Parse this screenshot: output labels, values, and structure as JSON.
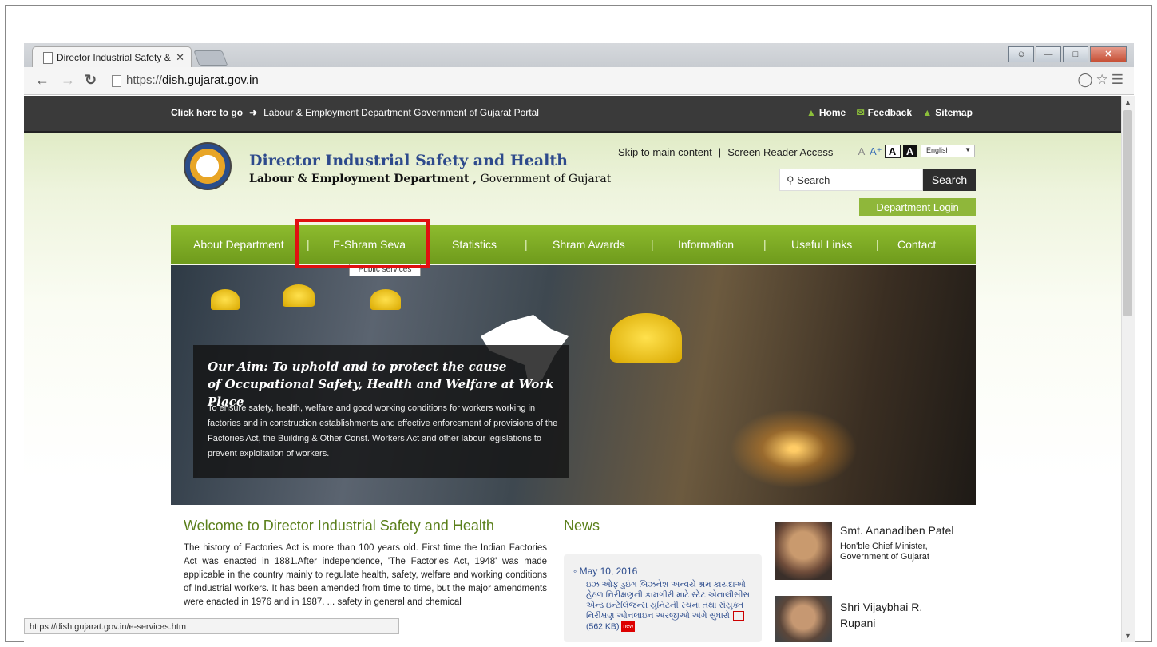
{
  "browser": {
    "tab_title": "Director Industrial Safety & ",
    "tab_close": "✕",
    "url_scheme": "https://",
    "url_domain": "dish.gujarat.gov.in",
    "status_url": "https://dish.gujarat.gov.in/e-services.htm"
  },
  "topbar": {
    "click_here": "Click here to go",
    "portal_link": "Labour & Employment Department Government of Gujarat Portal",
    "home": "Home",
    "feedback": "Feedback",
    "sitemap": "Sitemap"
  },
  "header": {
    "title": "Director Industrial Safety and Health",
    "subtitle_bold": "Labour & Employment Department ,",
    "subtitle_rest": " Government of Gujarat",
    "skip": "Skip to main content",
    "screen_reader": "Screen Reader Access",
    "font_sizes": [
      "A",
      "A⁺",
      "A",
      "A"
    ],
    "language": "English",
    "search_placeholder": "Search",
    "search_button": "Search",
    "dept_login": "Department Login"
  },
  "menu": {
    "items": [
      "About Department",
      "E-Shram Seva",
      "Statistics",
      "Shram Awards",
      "Information",
      "Useful Links",
      "Contact"
    ],
    "tooltip": "Public services"
  },
  "banner": {
    "aim_line1": "Our Aim: To uphold and to protect the cause",
    "aim_line2": "of Occupational Safety, Health and Welfare at Work Place",
    "aim_text": "To ensure safety, health, welfare and good working conditions for workers working in factories and in construction establishments and effective enforcement of provisions of the Factories Act, the Building & Other Const. Workers Act and other labour legislations to prevent exploitation of workers."
  },
  "welcome": {
    "title": "Welcome to Director Industrial Safety and Health",
    "text": "The history of Factories Act is more than 100 years old. First time the Indian Factories Act was enacted in 1881.After independence, 'The Factories Act, 1948' was made applicable in the country mainly to regulate health, safety, welfare and working conditions of Industrial workers. It has been amended from time to time, but the major amendments were enacted in 1976 and in 1987. ... safety in general and chemical"
  },
  "news": {
    "title": "News",
    "date": "May 10, 2016",
    "item": "ઇઝ ઓફ ડુઇંગ બિઝનેશ અન્વયે શ્રમ કાયદાઓ હેઠળ નિરીક્ષણની કામગીરી માટે સ્ટેટ એનાલીસીસ એન્ડ ઇન્ટેલિજન્સ યુનિટની રચના તથા સંયુક્ત નિરીક્ષણ ઓનલાઇન અરજીઓ અંગે સુધારો",
    "size": "(562 KB)",
    "new_badge": "new"
  },
  "people": {
    "p1_name": "Smt. Ananadiben Patel",
    "p1_role1": "Hon'ble Chief Minister,",
    "p1_role2": "Government of Gujarat",
    "p2_name": "Shri Vijaybhai R.",
    "p2_name2": "Rupani"
  }
}
